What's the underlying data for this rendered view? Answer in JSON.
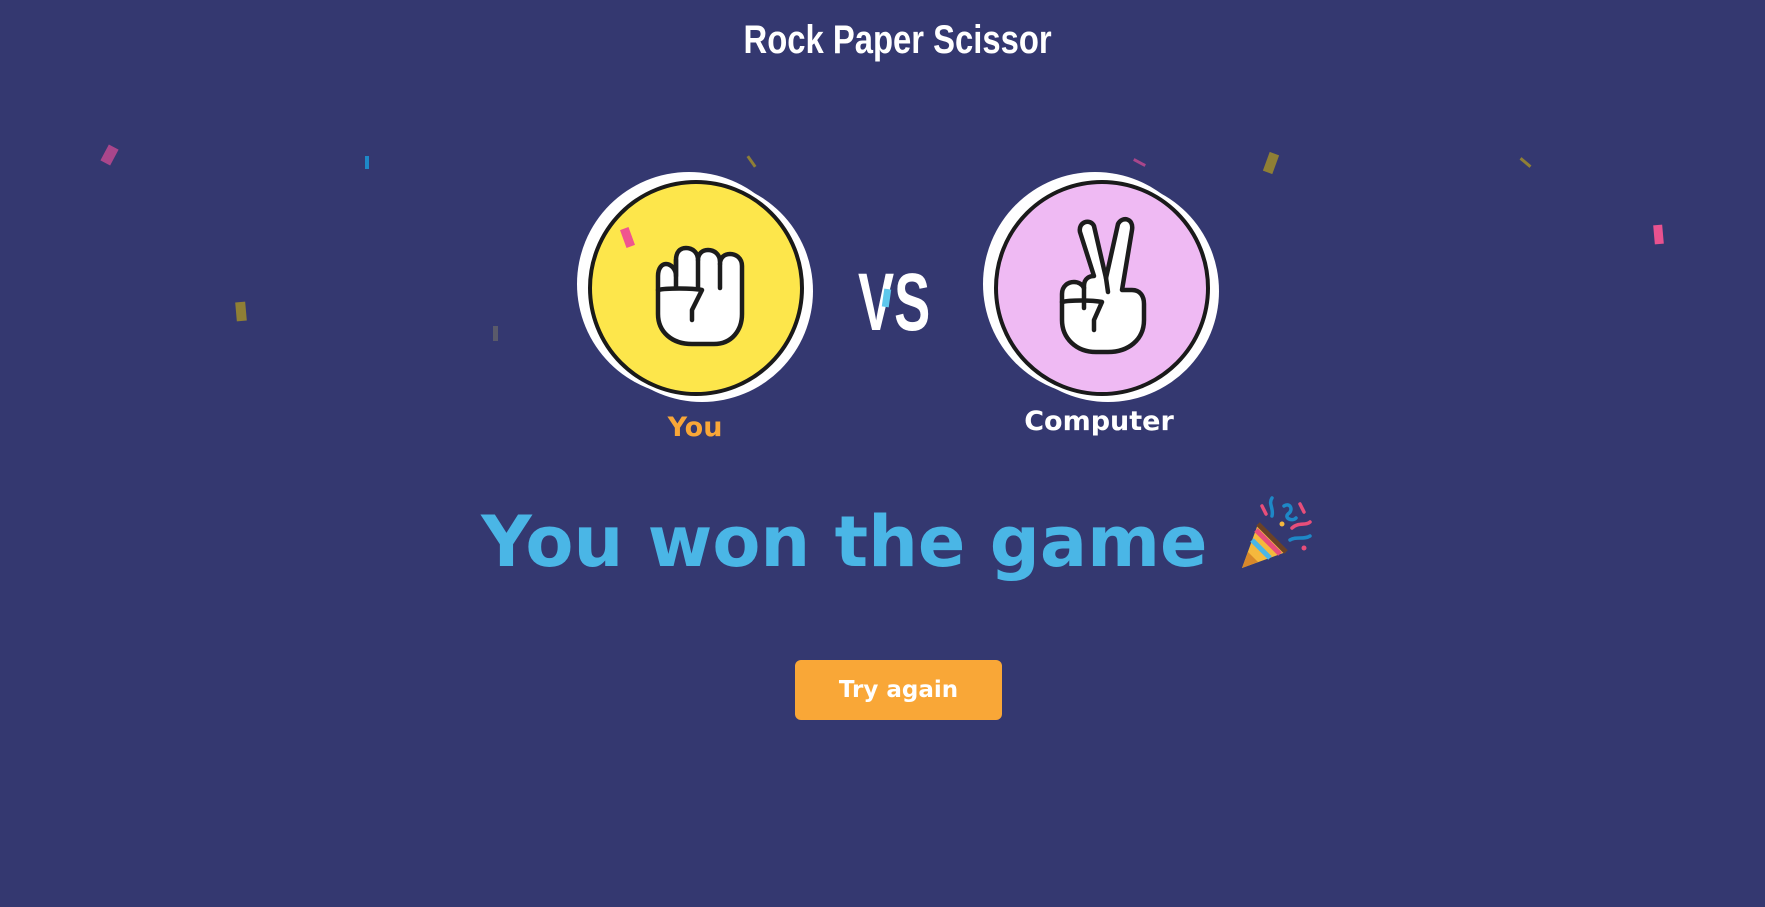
{
  "app": {
    "title": "Rock Paper Scissor"
  },
  "game": {
    "player": {
      "label": "You",
      "choice": "rock",
      "icon": "fist-icon",
      "badge_color": "#fde64b",
      "label_color": "#f9a737"
    },
    "versus_label": "VS",
    "computer": {
      "label": "Computer",
      "choice": "scissors",
      "icon": "peace-hand-icon",
      "badge_color": "#efbaf3",
      "label_color": "#ffffff"
    },
    "result_text": "You won the game",
    "result_icon": "party-popper-icon",
    "result_color": "#4ab6e6",
    "try_again_label": "Try again",
    "button_color": "#f9a737"
  },
  "theme": {
    "background": "#343870",
    "confetti_colors": [
      "#b0478f",
      "#1e88c7",
      "#8f7f35",
      "#e8528f",
      "#5ec8ec",
      "#5a5a6a"
    ]
  }
}
